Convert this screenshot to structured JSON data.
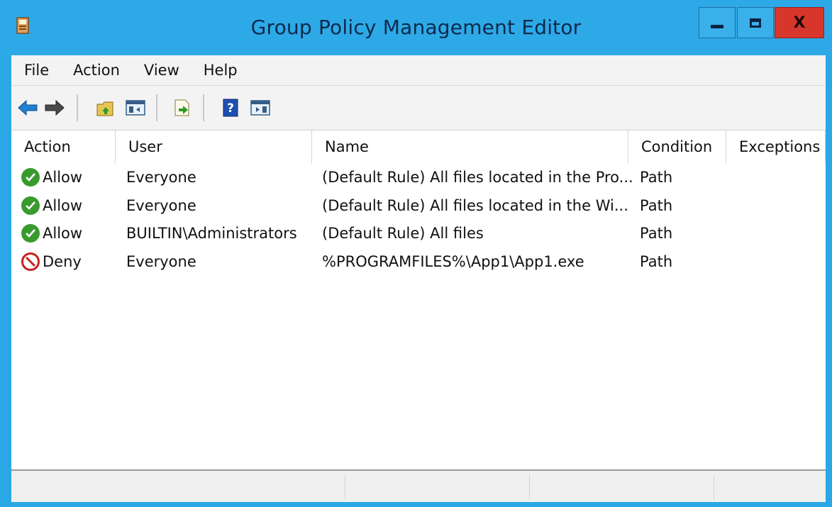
{
  "window": {
    "title": "Group Policy Management Editor",
    "controls": {
      "minimize": "minimize",
      "maximize": "maximize",
      "close": "X"
    }
  },
  "menubar": {
    "items": [
      "File",
      "Action",
      "View",
      "Help"
    ]
  },
  "toolbar": {
    "buttons": [
      {
        "name": "back-arrow-icon"
      },
      {
        "name": "forward-arrow-icon"
      },
      {
        "name": "up-folder-icon"
      },
      {
        "name": "show-hide-console-tree-icon"
      },
      {
        "name": "export-list-icon"
      },
      {
        "name": "help-icon"
      },
      {
        "name": "show-hide-action-pane-icon"
      }
    ]
  },
  "list": {
    "columns": [
      "Action",
      "User",
      "Name",
      "Condition",
      "Exceptions"
    ],
    "rows": [
      {
        "action": "Allow",
        "action_type": "allow",
        "user": "Everyone",
        "name": "(Default Rule) All files located in the Pro...",
        "condition": "Path",
        "exceptions": ""
      },
      {
        "action": "Allow",
        "action_type": "allow",
        "user": "Everyone",
        "name": "(Default Rule) All files located in the Wi...",
        "condition": "Path",
        "exceptions": ""
      },
      {
        "action": "Allow",
        "action_type": "allow",
        "user": "BUILTIN\\Administrators",
        "name": "(Default Rule) All files",
        "condition": "Path",
        "exceptions": ""
      },
      {
        "action": "Deny",
        "action_type": "deny",
        "user": "Everyone",
        "name": "%PROGRAMFILES%\\App1\\App1.exe",
        "condition": "Path",
        "exceptions": ""
      }
    ]
  },
  "colors": {
    "titlebar": "#2ea9e8",
    "allow_green": "#3a9a2e",
    "deny_red": "#c8211e",
    "close_red": "#d9362b"
  }
}
